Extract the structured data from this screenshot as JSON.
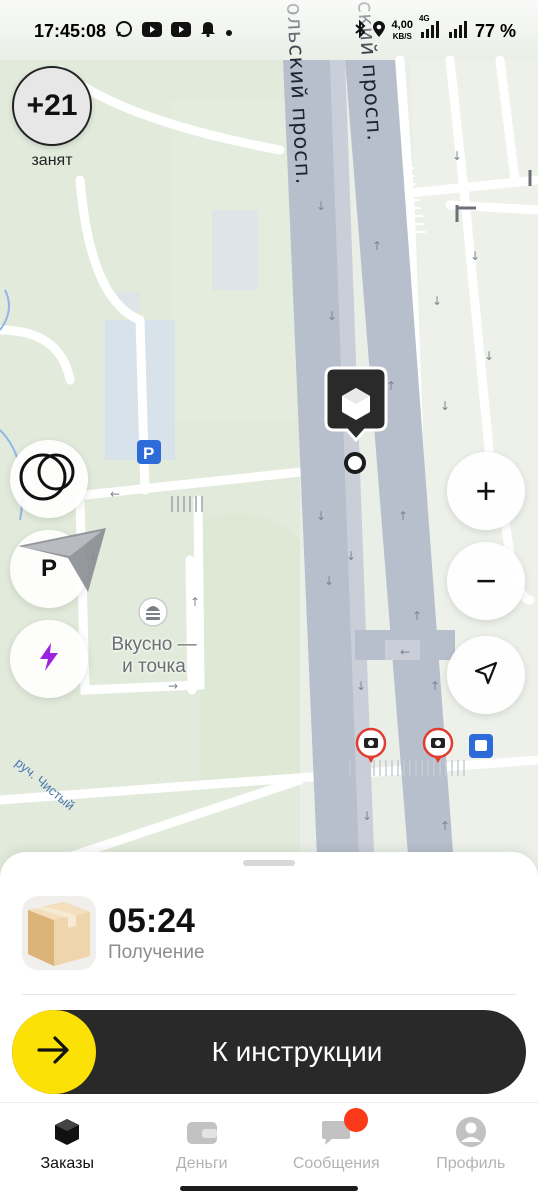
{
  "status_bar": {
    "time": "17:45:08",
    "notification_icons": [
      "whatsapp-icon",
      "youtube-icon",
      "youtube-icon",
      "bell-icon",
      "dot-icon"
    ],
    "net_speed_value": "4,00",
    "net_speed_unit": "KB/S",
    "network": "4G",
    "battery": "77 %"
  },
  "map": {
    "busy_count": "+21",
    "busy_label": "занят",
    "parking_label": "P",
    "poi_name": "Вкусно — и точка",
    "road_label_left": "ольский просп.",
    "road_label_right": "ский просп.",
    "stream_label": "руч. Чистый",
    "zoom_in": "+",
    "zoom_out": "−",
    "colors": {
      "road": "#b7bfcc",
      "park": "#dde9d4",
      "accent": "#fbe106",
      "lightning": "#9b22e0"
    }
  },
  "sheet": {
    "timer": "05:24",
    "caption": "Получение",
    "button_label": "К инструкции"
  },
  "tabs": [
    {
      "label": "Заказы",
      "icon": "orders-box-icon",
      "active": true
    },
    {
      "label": "Деньги",
      "icon": "wallet-icon",
      "active": false
    },
    {
      "label": "Сообщения",
      "icon": "chat-icon",
      "active": false
    },
    {
      "label": "Профиль",
      "icon": "profile-icon",
      "active": false
    }
  ]
}
